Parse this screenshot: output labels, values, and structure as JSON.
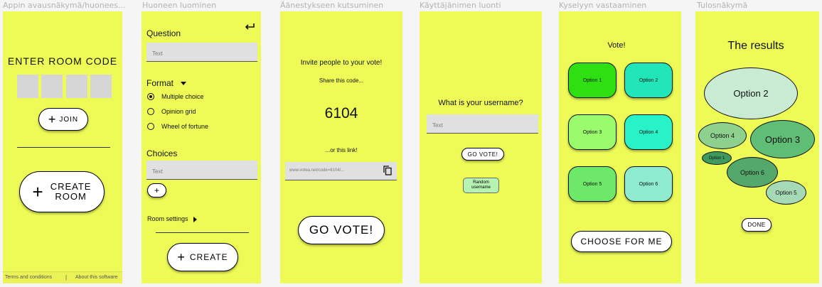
{
  "frames": [
    {
      "title": "Appin avausnäkymä/huonees..."
    },
    {
      "title": "Huoneen luominen"
    },
    {
      "title": "Äänestykseen kutsuminen"
    },
    {
      "title": "Käyttäjänimen luonti"
    },
    {
      "title": "Kyselyyn vastaaminen"
    },
    {
      "title": "Tulosnäkymä"
    }
  ],
  "screen1": {
    "heading": "ENTER ROOM CODE",
    "join_label": "JOIN",
    "create_line1": "CREATE",
    "create_line2": "ROOM",
    "footer_terms": "Terms and conditions",
    "footer_sep": "|",
    "footer_about": "About this software"
  },
  "screen2": {
    "question_label": "Question",
    "question_placeholder": "Text",
    "format_label": "Format",
    "formats": [
      "Multiple choice",
      "Opinion grid",
      "Wheel of fortune"
    ],
    "selected_format": "Multiple choice",
    "choices_label": "Choices",
    "choices_placeholder": "Text",
    "room_settings_label": "Room settings",
    "create_label": "CREATE"
  },
  "screen3": {
    "invite": "Invite people to your vote!",
    "share": "Share this code...",
    "code": "6104",
    "or_link": "...or this link!",
    "link": "www.votea.net/code=6104/...",
    "go_vote": "GO VOTE!"
  },
  "screen4": {
    "question": "What is your username?",
    "placeholder": "Text",
    "go_vote": "GO VOTE!",
    "random_line1": "Random",
    "random_line2": "username"
  },
  "screen5": {
    "title": "Vote!",
    "options": [
      {
        "label": "Option 1",
        "color": "#2ee012"
      },
      {
        "label": "Option 2",
        "color": "#21e6b9"
      },
      {
        "label": "Option 3",
        "color": "#9afb6c"
      },
      {
        "label": "Option 4",
        "color": "#28f2c8"
      },
      {
        "label": "Option 5",
        "color": "#6ee868"
      },
      {
        "label": "Option 6",
        "color": "#8eebd0"
      }
    ],
    "choose_for_me": "CHOOSE FOR ME"
  },
  "screen6": {
    "title": "The results",
    "bubbles": [
      {
        "label": "Option 2",
        "color": "#c9ead3"
      },
      {
        "label": "Option 4",
        "color": "#8ed18e"
      },
      {
        "label": "Option 3",
        "color": "#5fbd76"
      },
      {
        "label": "Option 1",
        "color": "#3f9a5d"
      },
      {
        "label": "Option 6",
        "color": "#55a86c"
      },
      {
        "label": "Option 5",
        "color": "#a6d9b6"
      }
    ],
    "done": "DONE"
  },
  "colors": {
    "screen_bg": "#eefb57",
    "canvas_bg": "#f5f5f5",
    "field_bg": "#e0e0e0",
    "random_btn_bg": "#b6f2b2"
  },
  "icons": [
    "plus-icon",
    "return-icon",
    "caret-down-icon",
    "caret-right-icon",
    "copy-icon"
  ]
}
